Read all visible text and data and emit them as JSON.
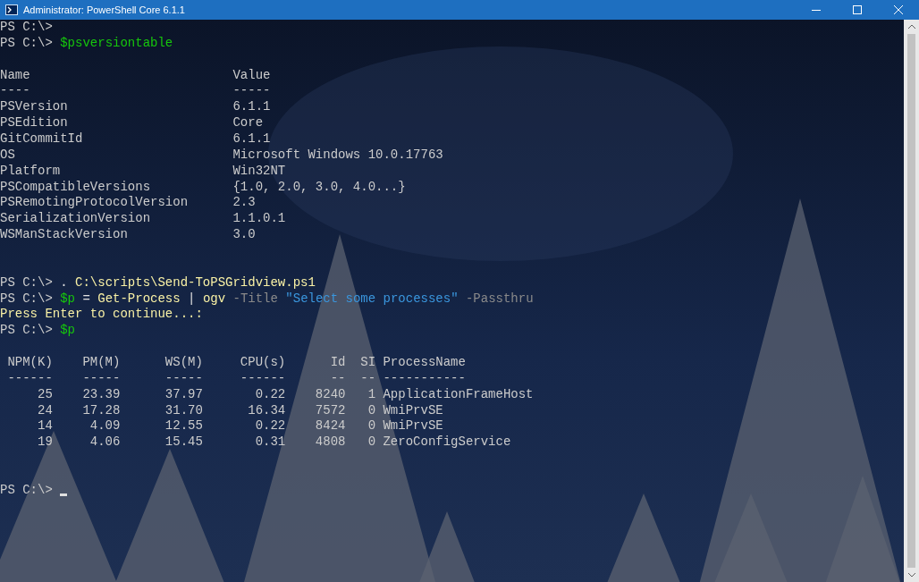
{
  "window": {
    "title": "Administrator: PowerShell Core 6.1.1"
  },
  "console": {
    "lines": [
      {
        "kind": "text",
        "segments": [
          {
            "kind": "prompt",
            "text": "PS C:\\> "
          }
        ]
      },
      {
        "kind": "text",
        "segments": [
          {
            "kind": "prompt",
            "text": "PS C:\\> "
          },
          {
            "kind": "variable",
            "text": "$psversiontable"
          }
        ]
      },
      {
        "kind": "blank"
      },
      {
        "kind": "text",
        "segments": [
          {
            "kind": "output",
            "text": "Name                           Value"
          }
        ]
      },
      {
        "kind": "text",
        "segments": [
          {
            "kind": "output",
            "text": "----                           -----"
          }
        ]
      },
      {
        "kind": "text",
        "segments": [
          {
            "kind": "output",
            "text": "PSVersion                      6.1.1"
          }
        ]
      },
      {
        "kind": "text",
        "segments": [
          {
            "kind": "output",
            "text": "PSEdition                      Core"
          }
        ]
      },
      {
        "kind": "text",
        "segments": [
          {
            "kind": "output",
            "text": "GitCommitId                    6.1.1"
          }
        ]
      },
      {
        "kind": "text",
        "segments": [
          {
            "kind": "output",
            "text": "OS                             Microsoft Windows 10.0.17763"
          }
        ]
      },
      {
        "kind": "text",
        "segments": [
          {
            "kind": "output",
            "text": "Platform                       Win32NT"
          }
        ]
      },
      {
        "kind": "text",
        "segments": [
          {
            "kind": "output",
            "text": "PSCompatibleVersions           {1.0, 2.0, 3.0, 4.0...}"
          }
        ]
      },
      {
        "kind": "text",
        "segments": [
          {
            "kind": "output",
            "text": "PSRemotingProtocolVersion      2.3"
          }
        ]
      },
      {
        "kind": "text",
        "segments": [
          {
            "kind": "output",
            "text": "SerializationVersion           1.1.0.1"
          }
        ]
      },
      {
        "kind": "text",
        "segments": [
          {
            "kind": "output",
            "text": "WSManStackVersion              3.0"
          }
        ]
      },
      {
        "kind": "blank"
      },
      {
        "kind": "blank"
      },
      {
        "kind": "text",
        "segments": [
          {
            "kind": "prompt",
            "text": "PS C:\\> "
          },
          {
            "kind": "operator",
            "text": ". "
          },
          {
            "kind": "command",
            "text": "C:\\scripts\\Send-ToPSGridview.ps1"
          }
        ]
      },
      {
        "kind": "text",
        "segments": [
          {
            "kind": "prompt",
            "text": "PS C:\\> "
          },
          {
            "kind": "variable",
            "text": "$p"
          },
          {
            "kind": "operator",
            "text": " = "
          },
          {
            "kind": "command",
            "text": "Get-Process"
          },
          {
            "kind": "operator",
            "text": " | "
          },
          {
            "kind": "command",
            "text": "ogv"
          },
          {
            "kind": "parameter",
            "text": " -Title "
          },
          {
            "kind": "string",
            "text": "\"Select some processes\""
          },
          {
            "kind": "parameter",
            "text": " -Passthru"
          }
        ]
      },
      {
        "kind": "text",
        "segments": [
          {
            "kind": "message",
            "text": "Press Enter to continue...:"
          }
        ]
      },
      {
        "kind": "text",
        "segments": [
          {
            "kind": "prompt",
            "text": "PS C:\\> "
          },
          {
            "kind": "variable",
            "text": "$p"
          }
        ]
      },
      {
        "kind": "blank"
      },
      {
        "kind": "text",
        "segments": [
          {
            "kind": "output",
            "text": " NPM(K)    PM(M)      WS(M)     CPU(s)      Id  SI ProcessName"
          }
        ]
      },
      {
        "kind": "text",
        "segments": [
          {
            "kind": "output",
            "text": " ------    -----      -----     ------      --  -- -----------"
          }
        ]
      },
      {
        "kind": "text",
        "segments": [
          {
            "kind": "output",
            "text": "     25    23.39      37.97       0.22    8240   1 ApplicationFrameHost"
          }
        ]
      },
      {
        "kind": "text",
        "segments": [
          {
            "kind": "output",
            "text": "     24    17.28      31.70      16.34    7572   0 WmiPrvSE"
          }
        ]
      },
      {
        "kind": "text",
        "segments": [
          {
            "kind": "output",
            "text": "     14     4.09      12.55       0.22    8424   0 WmiPrvSE"
          }
        ]
      },
      {
        "kind": "text",
        "segments": [
          {
            "kind": "output",
            "text": "     19     4.06      15.45       0.31    4808   0 ZeroConfigService"
          }
        ]
      },
      {
        "kind": "blank"
      },
      {
        "kind": "blank"
      },
      {
        "kind": "text",
        "cursor": true,
        "segments": [
          {
            "kind": "prompt",
            "text": "PS C:\\> "
          }
        ]
      }
    ]
  }
}
